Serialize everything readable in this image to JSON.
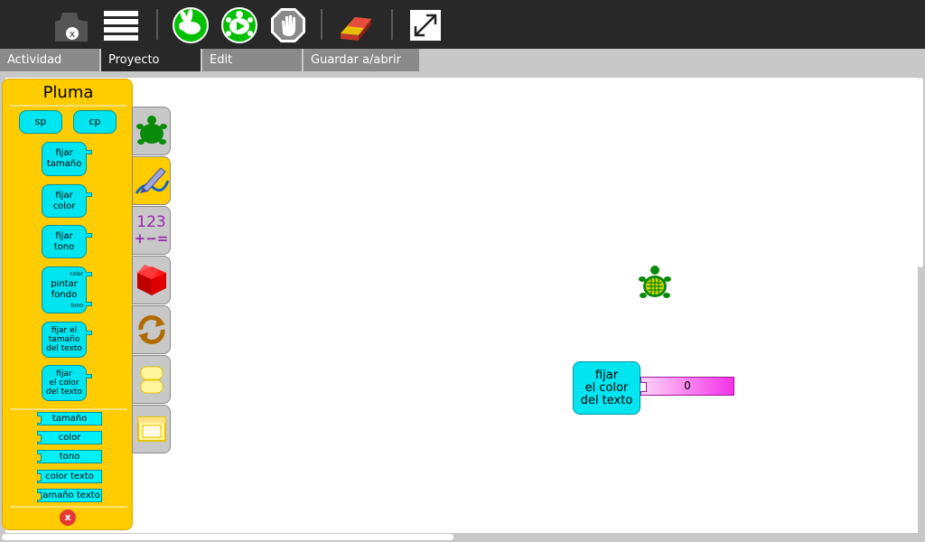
{
  "toolbar": {
    "buttons": [
      {
        "name": "stop-project-button",
        "icon": "x-badge-icon"
      },
      {
        "name": "project-menu-button",
        "icon": "stripes-icon"
      },
      {
        "name": "run-fast-button",
        "icon": "rabbit-icon"
      },
      {
        "name": "run-slow-button",
        "icon": "turtle-play-icon"
      },
      {
        "name": "stop-button",
        "icon": "stop-hand-icon"
      },
      {
        "name": "clear-button",
        "icon": "eraser-icon"
      },
      {
        "name": "fullscreen-button",
        "icon": "expand-icon"
      }
    ],
    "stop_badge": "x"
  },
  "tabs": [
    {
      "label": "Actividad",
      "active": false
    },
    {
      "label": "Proyecto",
      "active": true
    },
    {
      "label": "Edit",
      "active": false
    },
    {
      "label": "Guardar a/abrir de",
      "active": false
    }
  ],
  "palette": {
    "title": "Pluma",
    "top_blocks": [
      "sp",
      "cp"
    ],
    "blocks": [
      {
        "label": "fijar\ntamaño"
      },
      {
        "label": "fijar\ncolor"
      },
      {
        "label": "fijar\ntono"
      },
      {
        "label": "pintar\nfondo",
        "sub_top": "color",
        "sub_bottom": "tono"
      },
      {
        "label": "fijar el\ntamaño\ndel texto"
      },
      {
        "label": "fijar\nel color\ndel texto"
      }
    ],
    "args": [
      "tamaño",
      "color",
      "tono",
      "color texto",
      "tamaño texto"
    ],
    "close_label": "x"
  },
  "side_tabs": [
    {
      "name": "turtle-palette-tab",
      "icon": "turtle-icon",
      "active": false
    },
    {
      "name": "pen-palette-tab",
      "icon": "pen-icon",
      "active": true
    },
    {
      "name": "numbers-palette-tab",
      "icon": "numbers-icon",
      "label_top": "123",
      "label_bottom": "+−=",
      "active": false
    },
    {
      "name": "boxes-palette-tab",
      "icon": "box-icon",
      "active": false
    },
    {
      "name": "flow-palette-tab",
      "icon": "loop-arrows-icon",
      "active": false
    },
    {
      "name": "blocks-palette-tab",
      "icon": "blocks-icon",
      "active": false
    },
    {
      "name": "extras-palette-tab",
      "icon": "extras-icon",
      "active": false
    }
  ],
  "canvas": {
    "block_label": "fijar\nel color\ndel texto",
    "number_value": "0"
  },
  "colors": {
    "toolbar_bg": "#282828",
    "palette_bg": "#ffcc00",
    "block_fill": "#00e5f0",
    "number_fill": "#f233e8",
    "turtle_green": "#0a8a0a"
  }
}
